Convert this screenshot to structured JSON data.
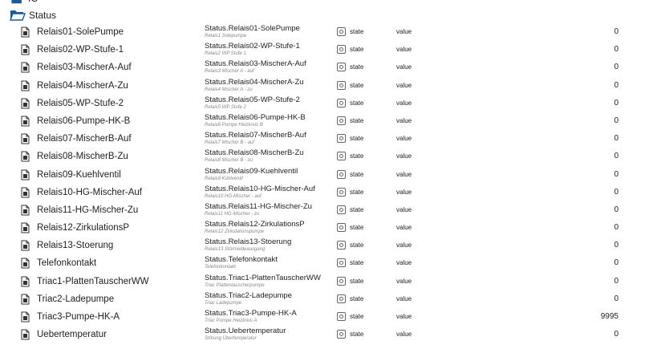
{
  "tree": {
    "cut_parent_label": "IO",
    "folder_label": "Status",
    "rows": [
      {
        "name": "Relais01-SolePumpe",
        "id": "Status.Relais01-SolePumpe",
        "desc": "Relais1 Solepumpe",
        "role": "state",
        "type": "value",
        "value": "0"
      },
      {
        "name": "Relais02-WP-Stufe-1",
        "id": "Status.Relais02-WP-Stufe-1",
        "desc": "Relais2 WP Stufe 1",
        "role": "state",
        "type": "value",
        "value": "0"
      },
      {
        "name": "Relais03-MischerA-Auf",
        "id": "Status.Relais03-MischerA-Auf",
        "desc": "Relais3 Mischer A - auf",
        "role": "state",
        "type": "value",
        "value": "0"
      },
      {
        "name": "Relais04-MischerA-Zu",
        "id": "Status.Relais04-MischerA-Zu",
        "desc": "Relais4 Mischer A - zu",
        "role": "state",
        "type": "value",
        "value": "0"
      },
      {
        "name": "Relais05-WP-Stufe-2",
        "id": "Status.Relais05-WP-Stufe-2",
        "desc": "Relais5 WP Stufe 2",
        "role": "state",
        "type": "value",
        "value": "0"
      },
      {
        "name": "Relais06-Pumpe-HK-B",
        "id": "Status.Relais06-Pumpe-HK-B",
        "desc": "Relais6 Pumpe Heizkreis B",
        "role": "state",
        "type": "value",
        "value": "0"
      },
      {
        "name": "Relais07-MischerB-Auf",
        "id": "Status.Relais07-MischerB-Auf",
        "desc": "Relais7 Mischer B - auf",
        "role": "state",
        "type": "value",
        "value": "0"
      },
      {
        "name": "Relais08-MischerB-Zu",
        "id": "Status.Relais08-MischerB-Zu",
        "desc": "Relais8 Mischer B - zu",
        "role": "state",
        "type": "value",
        "value": "0"
      },
      {
        "name": "Relais09-Kuehlventil",
        "id": "Status.Relais09-Kuehlventil",
        "desc": "Relais9 Kühlventil",
        "role": "state",
        "type": "value",
        "value": "0"
      },
      {
        "name": "Relais10-HG-Mischer-Auf",
        "id": "Status.Relais10-HG-Mischer-Auf",
        "desc": "Relais10 HG-Mischer - auf",
        "role": "state",
        "type": "value",
        "value": "0"
      },
      {
        "name": "Relais11-HG-Mischer-Zu",
        "id": "Status.Relais11-HG-Mischer-Zu",
        "desc": "Relais11 HG-Mischer - zu",
        "role": "state",
        "type": "value",
        "value": "0"
      },
      {
        "name": "Relais12-ZirkulationsP",
        "id": "Status.Relais12-ZirkulationsP",
        "desc": "Relais12 Zirkulationspumpe",
        "role": "state",
        "type": "value",
        "value": "0"
      },
      {
        "name": "Relais13-Stoerung",
        "id": "Status.Relais13-Stoerung",
        "desc": "Relais13 Störmeldeausgang",
        "role": "state",
        "type": "value",
        "value": "0"
      },
      {
        "name": "Telefonkontakt",
        "id": "Status.Telefonkontakt",
        "desc": "Telefonkontakt",
        "role": "state",
        "type": "value",
        "value": "0"
      },
      {
        "name": "Triac1-PlattenTauscherWW",
        "id": "Status.Triac1-PlattenTauscherWW",
        "desc": "Triac Plattentauscherpumpe",
        "role": "state",
        "type": "value",
        "value": "0"
      },
      {
        "name": "Triac2-Ladepumpe",
        "id": "Status.Triac2-Ladepumpe",
        "desc": "Triac Ladepumpe",
        "role": "state",
        "type": "value",
        "value": "0"
      },
      {
        "name": "Triac3-Pumpe-HK-A",
        "id": "Status.Triac3-Pumpe-HK-A",
        "desc": "Triac Pumpe Heizkreis A",
        "role": "state",
        "type": "value",
        "value": "9995"
      },
      {
        "name": "Uebertemperatur",
        "id": "Status.Uebertemperatur",
        "desc": "Störung Übertemperatur",
        "role": "state",
        "type": "value",
        "value": "0"
      }
    ]
  },
  "colors": {
    "folder_blue": "#1a5a96",
    "icon": "#333333"
  }
}
